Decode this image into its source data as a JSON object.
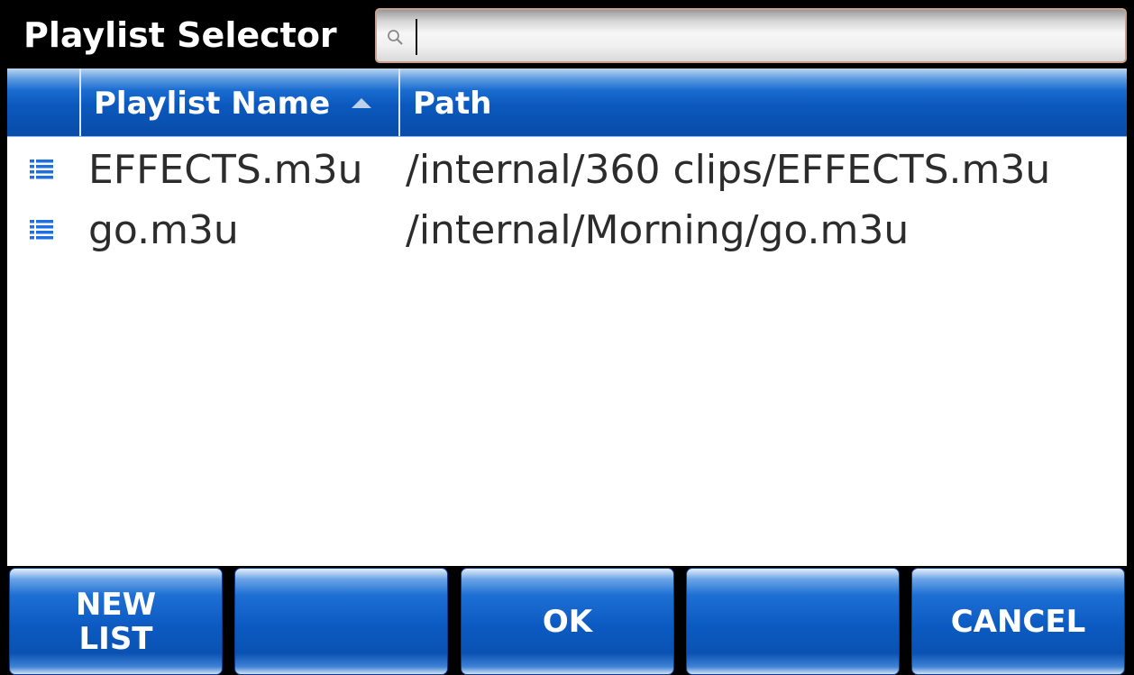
{
  "window": {
    "title": "Playlist Selector"
  },
  "search": {
    "placeholder": "",
    "value": ""
  },
  "table": {
    "columns": [
      "Playlist Name",
      "Path"
    ],
    "sort_column": "Playlist Name",
    "sort_direction": "ascending",
    "rows": [
      {
        "name": "EFFECTS.m3u",
        "path": "/internal/360 clips/EFFECTS.m3u",
        "icon": "playlist-icon"
      },
      {
        "name": "go.m3u",
        "path": "/internal/Morning/go.m3u",
        "icon": "playlist-icon"
      }
    ]
  },
  "buttons": {
    "new_list": "NEW\nLIST",
    "slot2": "",
    "ok": "OK",
    "slot4": "",
    "cancel": "CANCEL"
  },
  "colors": {
    "header_blue": "#0b58bd",
    "icon_blue": "#1f6fe0",
    "search_border": "#c9a08f"
  }
}
